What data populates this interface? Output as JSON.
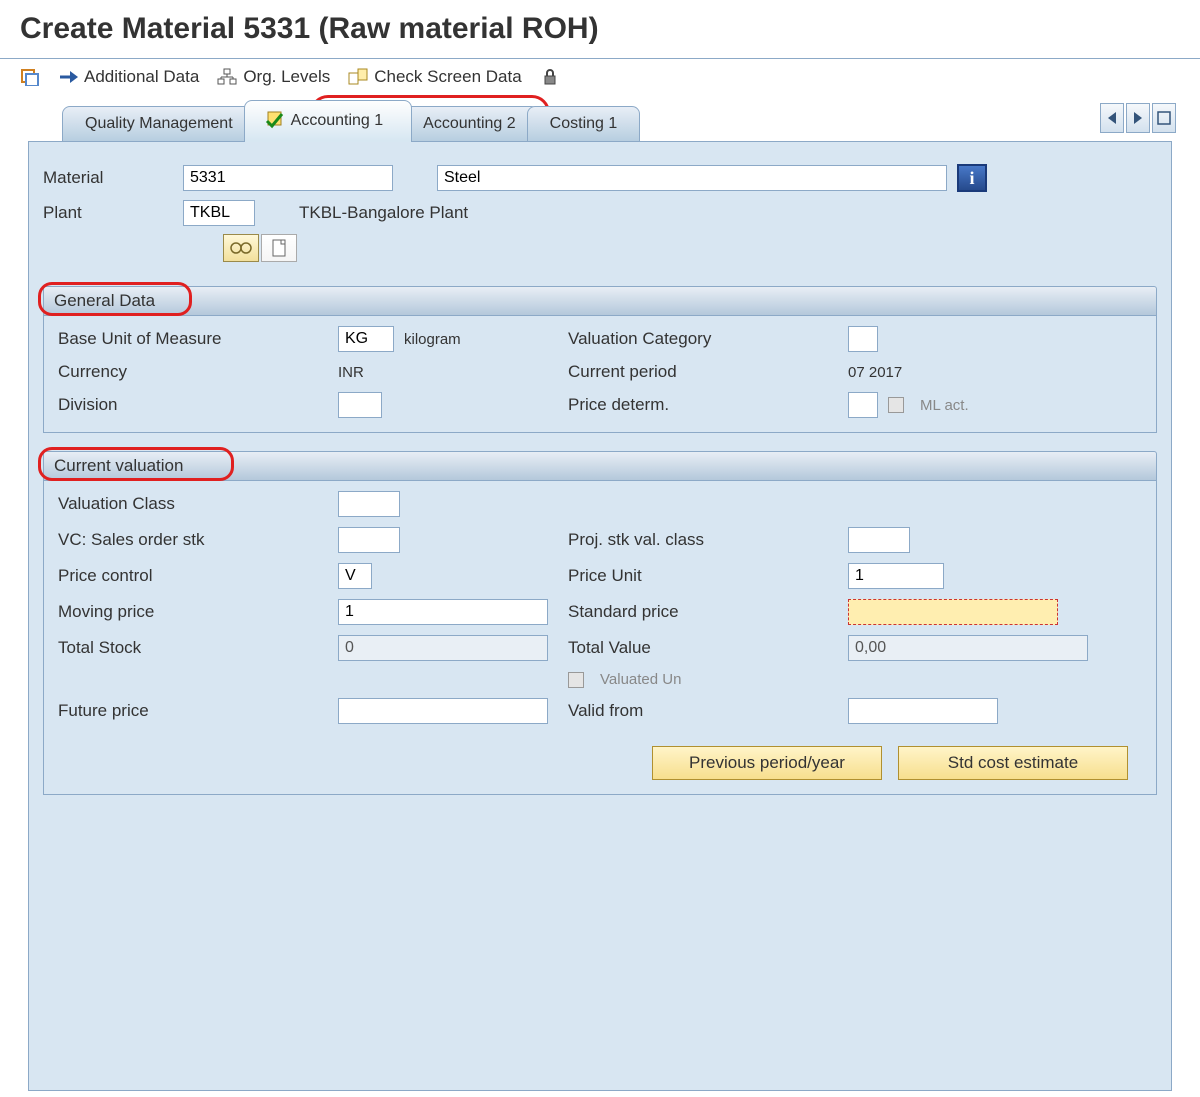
{
  "title": "Create Material 5331 (Raw material ROH)",
  "toolbar": {
    "additional_data": "Additional Data",
    "org_levels": "Org. Levels",
    "check_screen": "Check Screen Data"
  },
  "tabs": {
    "t1": "Quality Management",
    "t2": "Accounting 1",
    "t3": "Accounting 2",
    "t4": "Costing 1"
  },
  "header": {
    "material_lbl": "Material",
    "material_val": "5331",
    "material_desc": "Steel",
    "plant_lbl": "Plant",
    "plant_val": "TKBL",
    "plant_desc": "TKBL-Bangalore Plant"
  },
  "general": {
    "title": "General Data",
    "base_uom_lbl": "Base Unit of Measure",
    "base_uom_val": "KG",
    "base_uom_txt": "kilogram",
    "valuation_cat_lbl": "Valuation Category",
    "valuation_cat_val": "",
    "currency_lbl": "Currency",
    "currency_val": "INR",
    "current_period_lbl": "Current period",
    "current_period_val": "07 2017",
    "division_lbl": "Division",
    "division_val": "",
    "price_determ_lbl": "Price determ.",
    "price_determ_val": "",
    "ml_act_lbl": "ML act."
  },
  "valuation": {
    "title": "Current valuation",
    "val_class_lbl": "Valuation Class",
    "val_class_val": "",
    "vc_sales_lbl": "VC: Sales order stk",
    "vc_sales_val": "",
    "proj_stk_lbl": "Proj. stk val. class",
    "proj_stk_val": "",
    "price_control_lbl": "Price control",
    "price_control_val": "V",
    "price_unit_lbl": "Price Unit",
    "price_unit_val": "1",
    "moving_price_lbl": "Moving price",
    "moving_price_val": "1",
    "std_price_lbl": "Standard price",
    "std_price_val": "",
    "total_stock_lbl": "Total Stock",
    "total_stock_val": "0",
    "total_value_lbl": "Total Value",
    "total_value_val": "0,00",
    "valuated_un_lbl": "Valuated Un",
    "future_price_lbl": "Future price",
    "future_price_val": "",
    "valid_from_lbl": "Valid from",
    "valid_from_val": "",
    "prev_period_btn": "Previous period/year",
    "std_cost_btn": "Std cost estimate"
  }
}
